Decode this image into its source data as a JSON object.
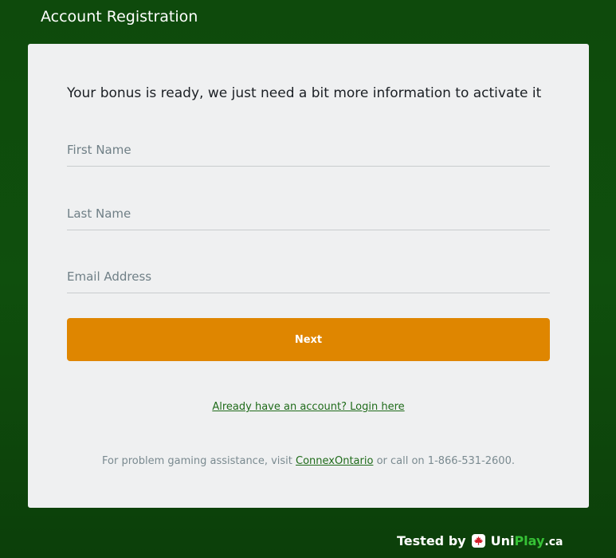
{
  "header": {
    "title": "Account Registration"
  },
  "form": {
    "headline": "Your bonus is ready, we just need a bit more information to activate it",
    "first_name_placeholder": "First Name",
    "last_name_placeholder": "Last Name",
    "email_placeholder": "Email Address",
    "next_label": "Next",
    "login_link": "Already have an account? Login here"
  },
  "footer": {
    "assist_prefix": "For problem gaming assistance, visit ",
    "assist_link": "ConnexOntario",
    "assist_suffix": " or call on 1-866-531-2600."
  },
  "badge": {
    "tested_by": "Tested by",
    "brand_uni": "Uni",
    "brand_play": "Play",
    "brand_tld": ".ca",
    "logo_icon": "maple-leaf-icon"
  },
  "colors": {
    "background": "#0f4f0d",
    "card": "#eff0f1",
    "button": "#df8600",
    "link": "#1f6b1a",
    "brand_play": "#36c236"
  }
}
